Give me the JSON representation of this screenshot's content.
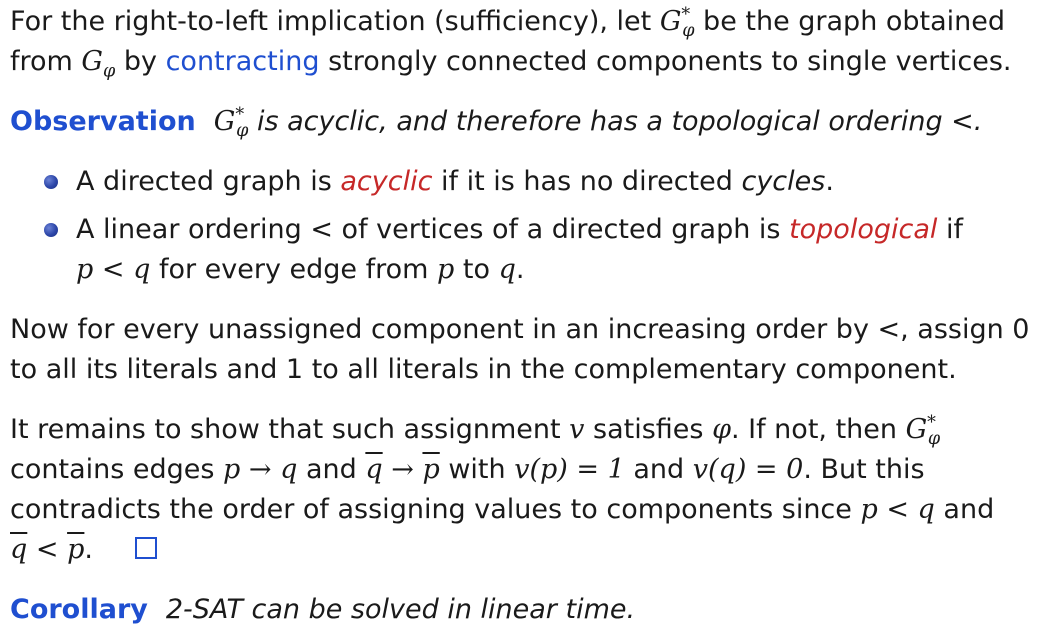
{
  "p1": {
    "t1": "For the right-to-left implication (sufficiency), let ",
    "g": "G",
    "g_sup": "*",
    "g_sub": "φ",
    "t2": " be the graph obtained from ",
    "g2": "G",
    "g2_sub": "φ",
    "t3": " by ",
    "link": "contracting",
    "t4": " strongly connected components to single vertices."
  },
  "observation": {
    "label": "Observation",
    "g": "G",
    "g_sup": "*",
    "g_sub": "φ",
    "text": " is acyclic, and therefore has a topological ordering <."
  },
  "bullets": {
    "b1": {
      "t1": "A directed graph is ",
      "red": "acyclic",
      "t2": " if it is has no directed ",
      "it": "cycles",
      "t3": "."
    },
    "b2": {
      "t1": "A linear ordering < of vertices of a directed graph is ",
      "red": "topological",
      "t2": " if",
      "p": "p",
      "lt": " < ",
      "q": "q",
      "t3": " for every edge from ",
      "p2": "p",
      "t4": " to ",
      "q2": "q",
      "t5": "."
    }
  },
  "p2": {
    "line1": "Now for every unassigned component in an increasing order by <, assign 0",
    "line2": "to all its literals and 1 to all literals in the complementary component."
  },
  "p3": {
    "t1": "It remains to show that such assignment ",
    "v": "v",
    "t2": " satisfies ",
    "phi": "φ",
    "t3": ". If not, then ",
    "g": "G",
    "g_sup": "*",
    "g_sub": "φ",
    "t4": "contains edges ",
    "e1": "p → q",
    "t5": " and ",
    "qbar": "q",
    "arrow": " → ",
    "pbar": "p",
    "t6": " with ",
    "v1": "v(p) = 1",
    "t7": " and ",
    "v2": "v(q) = 0",
    "t8": ". But this",
    "t9": "contradicts the order of assigning values to components since ",
    "plq": "p < q",
    "t10": " and",
    "qbar2": "q",
    "lt2": " < ",
    "pbar2": "p",
    "t11": "."
  },
  "corollary": {
    "label": "Corollary",
    "text": "2-SAT can be solved in linear time."
  },
  "colors": {
    "accent": "#1f4fd0",
    "emphasis": "#c62828"
  }
}
